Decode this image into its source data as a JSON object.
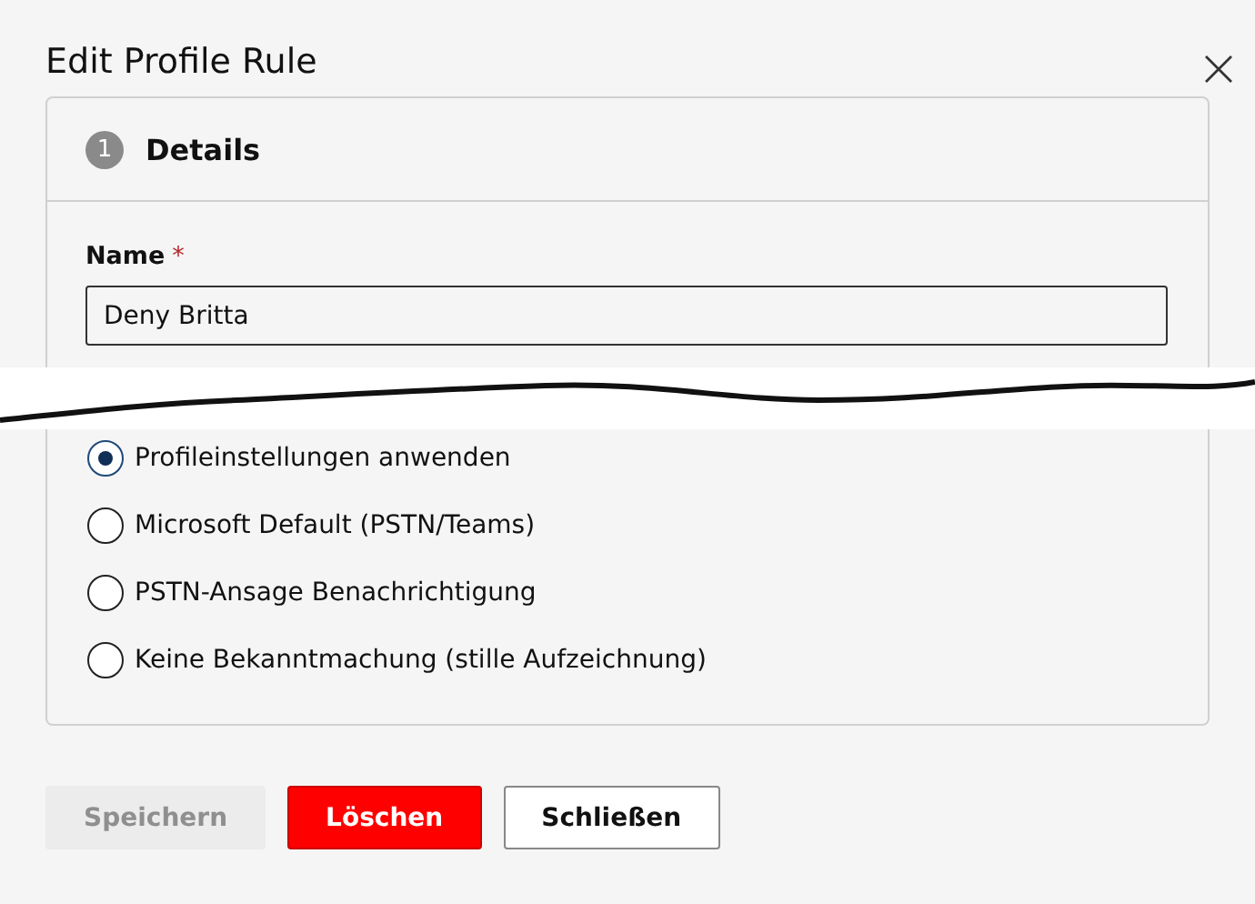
{
  "dialog": {
    "title": "Edit Profile Rule"
  },
  "section": {
    "step": "1",
    "title": "Details"
  },
  "name_field": {
    "label": "Name",
    "required_mark": "*",
    "value": "Deny Britta"
  },
  "options": [
    {
      "label": "Profileinstellungen anwenden",
      "selected": true
    },
    {
      "label": "Microsoft Default (PSTN/Teams)",
      "selected": false
    },
    {
      "label": "PSTN-Ansage Benachrichtigung",
      "selected": false
    },
    {
      "label": "Keine Bekanntmachung (stille Aufzeichnung)",
      "selected": false
    }
  ],
  "buttons": [
    {
      "label": "Speichern",
      "kind": "primary",
      "disabled": true
    },
    {
      "label": "Löschen",
      "kind": "danger",
      "disabled": false
    },
    {
      "label": "Schließen",
      "kind": "default",
      "disabled": false
    }
  ]
}
